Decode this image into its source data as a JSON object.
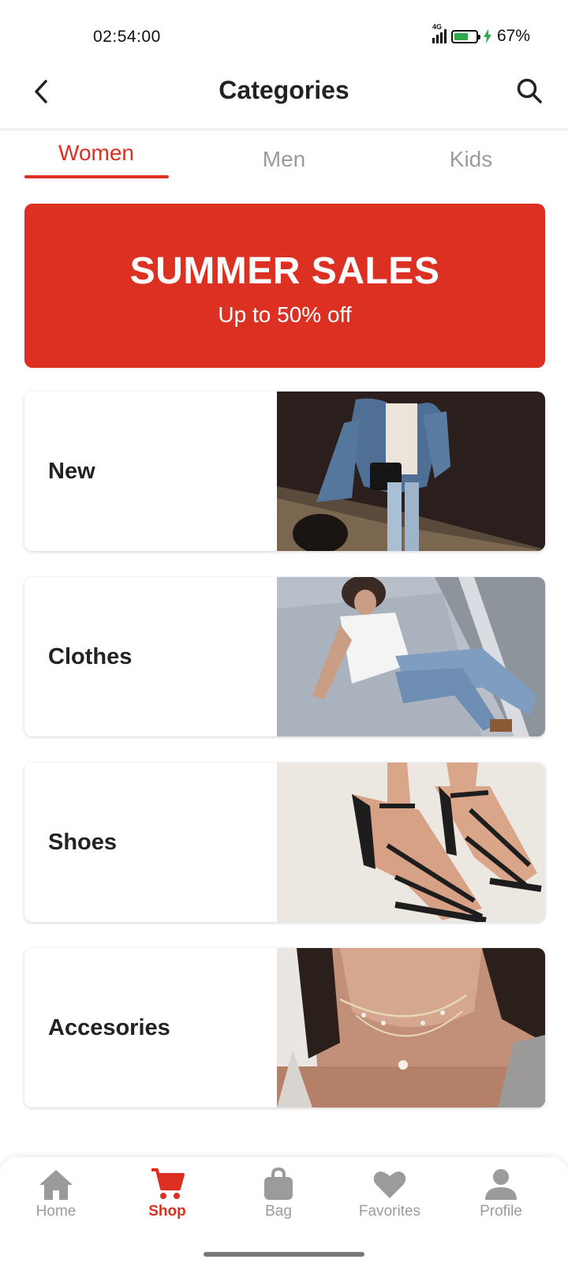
{
  "status_bar": {
    "time": "02:54:00",
    "network": "4G",
    "battery_percent": "67%",
    "battery_level": 0.67,
    "battery_color": "#2ea84a"
  },
  "header": {
    "title": "Categories",
    "back_icon": "chevron-left-icon",
    "search_icon": "search-icon"
  },
  "tabs": [
    {
      "label": "Women",
      "active": true
    },
    {
      "label": "Men",
      "active": false
    },
    {
      "label": "Kids",
      "active": false
    }
  ],
  "banner": {
    "title": "SUMMER SALES",
    "subtitle": "Up to 50% off"
  },
  "categories": [
    {
      "label": "New"
    },
    {
      "label": "Clothes"
    },
    {
      "label": "Shoes"
    },
    {
      "label": "Accesories"
    }
  ],
  "bottom_nav": [
    {
      "label": "Home",
      "icon": "home-icon",
      "active": false
    },
    {
      "label": "Shop",
      "icon": "cart-icon",
      "active": true
    },
    {
      "label": "Bag",
      "icon": "bag-icon",
      "active": false
    },
    {
      "label": "Favorites",
      "icon": "heart-icon",
      "active": false
    },
    {
      "label": "Profile",
      "icon": "profile-icon",
      "active": false
    }
  ],
  "colors": {
    "accent": "#db3022",
    "inactive": "#9b9b9b",
    "text": "#222222"
  }
}
